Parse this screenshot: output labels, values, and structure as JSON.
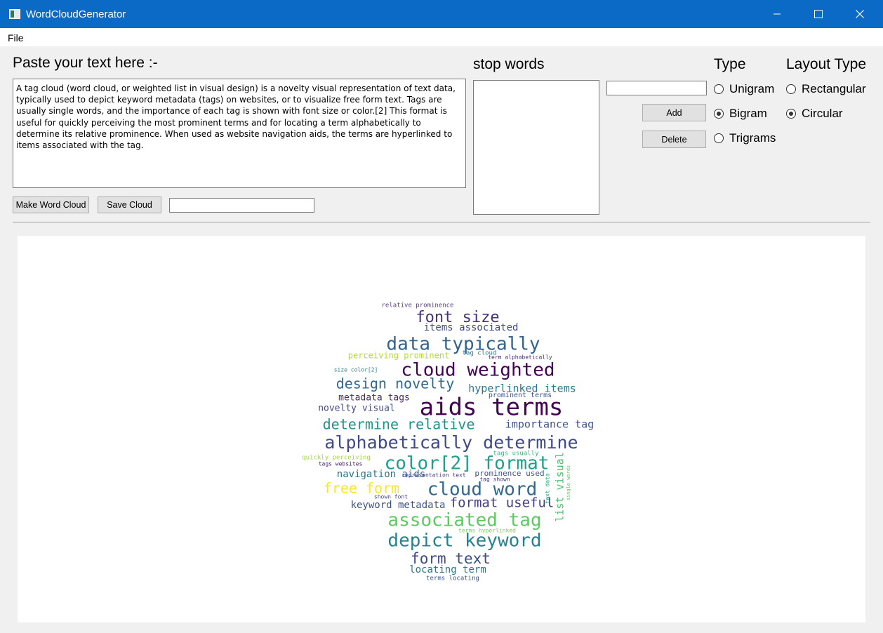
{
  "window": {
    "title": "WordCloudGenerator",
    "icons": {
      "minimize": "minimize-icon",
      "maximize": "maximize-icon",
      "close": "close-icon"
    }
  },
  "menu": {
    "file": "File"
  },
  "input_section": {
    "label": "Paste your text here :-",
    "text": "A tag cloud (word cloud, or weighted list in visual design) is a novelty visual representation of text data, typically used to depict keyword metadata (tags) on websites, or to visualize free form text. Tags are usually single words, and the importance of each tag is shown with font size or color.[2] This format is useful for quickly perceiving the most prominent terms and for locating a term alphabetically to determine its relative prominence. When used as website navigation aids, the terms are hyperlinked to items associated with the tag.",
    "make_button": "Make Word Cloud",
    "save_button": "Save Cloud",
    "filename_value": ""
  },
  "stopwords": {
    "label": "stop words",
    "input_value": "",
    "add_button": "Add",
    "delete_button": "Delete",
    "items": []
  },
  "type": {
    "label": "Type",
    "options": [
      {
        "label": "Unigram",
        "checked": false
      },
      {
        "label": "Bigram",
        "checked": true
      },
      {
        "label": "Trigrams",
        "checked": false
      }
    ]
  },
  "layout_type": {
    "label": "Layout Type",
    "options": [
      {
        "label": "Rectangular",
        "checked": false
      },
      {
        "label": "Circular",
        "checked": true
      }
    ]
  },
  "colors": {
    "titlebar": "#0b6ac6",
    "window_bg": "#f0f0f0",
    "button_bg": "#e1e1e1"
  },
  "word_cloud": {
    "words": [
      {
        "text": "relative prominence",
        "color": "#5b3f8a"
      },
      {
        "text": "font size",
        "color": "#46317e"
      },
      {
        "text": "items associated",
        "color": "#3e4a89"
      },
      {
        "text": "data typically",
        "color": "#33638d"
      },
      {
        "text": "perceiving prominent",
        "color": "#b5de2b"
      },
      {
        "text": "tag cloud",
        "color": "#2a788e"
      },
      {
        "text": "term alphabetically",
        "color": "#472d7b"
      },
      {
        "text": "size color[2]",
        "color": "#26828e"
      },
      {
        "text": "cloud weighted",
        "color": "#440154"
      },
      {
        "text": "design novelty",
        "color": "#31688e"
      },
      {
        "text": "hyperlinked items",
        "color": "#2a788e"
      },
      {
        "text": "metadata tags",
        "color": "#482878"
      },
      {
        "text": "prominent terms",
        "color": "#3b528b"
      },
      {
        "text": "aids terms",
        "color": "#440154"
      },
      {
        "text": "novelty visual",
        "color": "#3e4a89"
      },
      {
        "text": "determine relative",
        "color": "#21918c"
      },
      {
        "text": "importance tag",
        "color": "#3b528b"
      },
      {
        "text": "alphabetically determine",
        "color": "#3e4a89"
      },
      {
        "text": "quickly perceiving",
        "color": "#a0da39"
      },
      {
        "text": "tags usually",
        "color": "#35b779"
      },
      {
        "text": "tags websites",
        "color": "#482173"
      },
      {
        "text": "color[2] format",
        "color": "#1f9e89"
      },
      {
        "text": "navigation aids",
        "color": "#2c728e"
      },
      {
        "text": "representation text",
        "color": "#443a83"
      },
      {
        "text": "prominence used",
        "color": "#3b528b"
      },
      {
        "text": "tag shown",
        "color": "#443983"
      },
      {
        "text": "free form",
        "color": "#fde725"
      },
      {
        "text": "cloud word",
        "color": "#31688e"
      },
      {
        "text": "shown font",
        "color": "#404688"
      },
      {
        "text": "keyword metadata",
        "color": "#3b528b"
      },
      {
        "text": "format useful",
        "color": "#433e85"
      },
      {
        "text": "list visual",
        "color": "#4ac16d"
      },
      {
        "text": "text data",
        "color": "#22a884"
      },
      {
        "text": "single words",
        "color": "#5ec962"
      },
      {
        "text": "associated tag",
        "color": "#5ec962"
      },
      {
        "text": "terms hyperlinked",
        "color": "#7ad151"
      },
      {
        "text": "depict keyword",
        "color": "#26828e"
      },
      {
        "text": "form text",
        "color": "#3e4a89"
      },
      {
        "text": "locating term",
        "color": "#2a788e"
      },
      {
        "text": "terms locating",
        "color": "#3b528b"
      }
    ]
  }
}
